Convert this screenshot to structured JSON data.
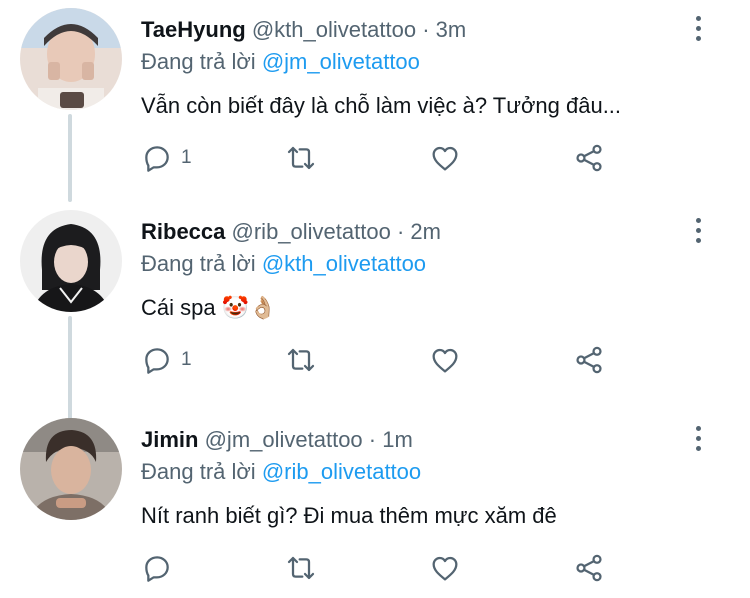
{
  "tweets": [
    {
      "name": "TaeHyung",
      "handle": "@kth_olivetattoo",
      "separator": "·",
      "time": "3m",
      "replying_label": "Đang trả lời",
      "replying_to": "@jm_olivetattoo",
      "text": "Vẫn còn biết đây là chỗ làm việc à? Tưởng đâu...",
      "reply_count": "1"
    },
    {
      "name": "Ribecca",
      "handle": "@rib_olivetattoo",
      "separator": "·",
      "time": "2m",
      "replying_label": "Đang trả lời",
      "replying_to": "@kth_olivetattoo",
      "text": "Cái spa 🤡👌🏼",
      "reply_count": "1"
    },
    {
      "name": "Jimin",
      "handle": "@jm_olivetattoo",
      "separator": "·",
      "time": "1m",
      "replying_label": "Đang trả lời",
      "replying_to": "@rib_olivetattoo",
      "text": "Nít ranh biết gì? Đi mua thêm mực xăm đê",
      "reply_count": ""
    }
  ],
  "icons": {
    "reply": "reply-icon",
    "retweet": "retweet-icon",
    "like": "like-icon",
    "share": "share-icon",
    "more": "more-options-icon"
  },
  "colors": {
    "text": "#0f1419",
    "secondary": "#536471",
    "link": "#1d9bf0",
    "thread_line": "#cfd9de"
  }
}
